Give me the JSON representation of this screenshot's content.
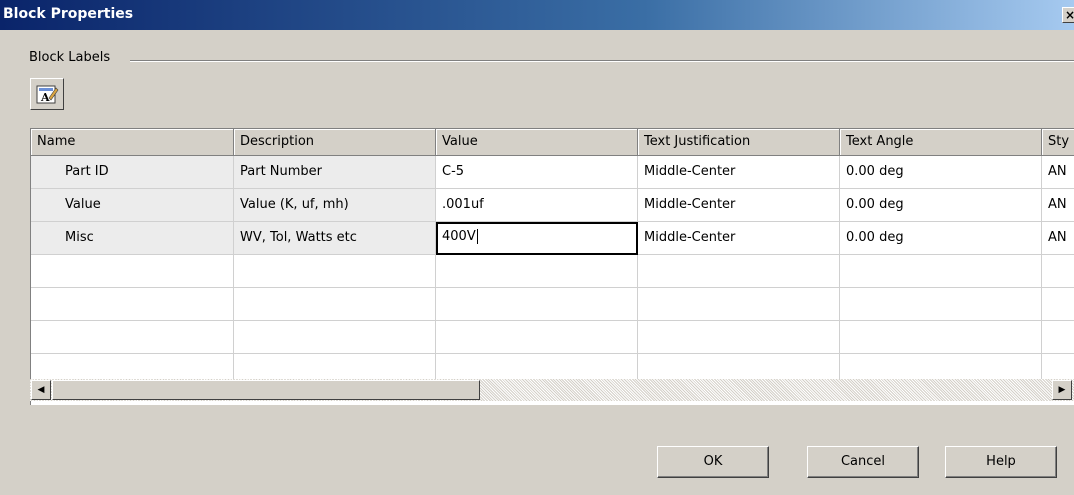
{
  "window": {
    "title": "Block Properties",
    "close_glyph": "×"
  },
  "group": {
    "label": "Block Labels"
  },
  "toolbar": {
    "icon": "label-text-icon"
  },
  "grid": {
    "columns": [
      "Name",
      "Description",
      "Value",
      "Text Justification",
      "Text Angle",
      "Sty"
    ],
    "rows": [
      [
        "Part ID",
        "Part Number",
        "C-5",
        "Middle-Center",
        "0.00 deg",
        "AN"
      ],
      [
        "Value",
        "Value (K, uf, mh)",
        ".001uf",
        "Middle-Center",
        "0.00 deg",
        "AN"
      ],
      [
        "Misc",
        "WV, Tol, Watts etc",
        "400V",
        "Middle-Center",
        "0.00 deg",
        "AN"
      ]
    ]
  },
  "scrollbar": {
    "left_arrow": "◀",
    "right_arrow": "▶"
  },
  "buttons": {
    "ok": "OK",
    "cancel": "Cancel",
    "help": "Help"
  }
}
